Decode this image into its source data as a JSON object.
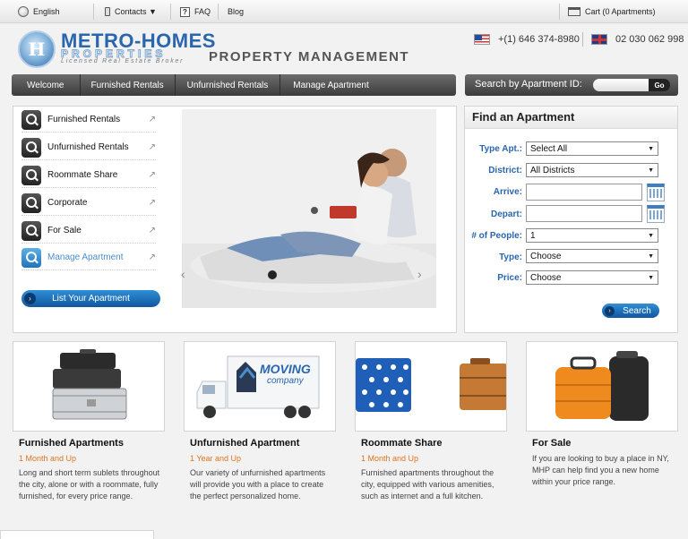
{
  "topbar": {
    "language": "English",
    "contacts": "Contacts ▼",
    "faq": "FAQ",
    "blog": "Blog",
    "cart": "Cart (0 Apartments)"
  },
  "header": {
    "logo_line1": "METRO-HOMES",
    "logo_line2": "PROPERTIES",
    "logo_tagline": "Licensed Real Estate Broker",
    "logo_initial": "H",
    "title": "PROPERTY MANAGEMENT",
    "phone_us": "+(1) 646 374-8980",
    "phone_uk": "02 030 062 998"
  },
  "nav": {
    "items": [
      "Welcome",
      "Furnished Rentals",
      "Unfurnished Rentals",
      "Manage Apartment"
    ],
    "search_label": "Search by Apartment ID:",
    "search_go": "Go"
  },
  "sidebar": {
    "items": [
      {
        "label": "Furnished Rentals"
      },
      {
        "label": "Unfurnished Rentals"
      },
      {
        "label": "Roommate Share"
      },
      {
        "label": "Corporate"
      },
      {
        "label": "For Sale"
      },
      {
        "label": "Manage Apartment"
      }
    ],
    "list_button": "List Your Apartment"
  },
  "find": {
    "title": "Find an Apartment",
    "type_label": "Type Apt.:",
    "type_value": "Select All",
    "district_label": "District:",
    "district_value": "All Districts",
    "arrive_label": "Arrive:",
    "depart_label": "Depart:",
    "people_label": "# of People:",
    "people_value": "1",
    "kind_label": "Type:",
    "kind_value": "Choose",
    "price_label": "Price:",
    "price_value": "Choose",
    "search_button": "Search"
  },
  "cards": [
    {
      "title": "Furnished Apartments",
      "sub": "1 Month and Up",
      "desc": "Long and short term sublets throughout the city, alone or with a roommate, fully furnished, for every price range."
    },
    {
      "title": "Unfurnished Apartment",
      "sub": "1 Year and Up",
      "desc": "Our variety of unfurnished apartments will provide you with a place to create the perfect personalized home."
    },
    {
      "title": "Roommate Share",
      "sub": "1 Month and Up",
      "desc": "Furnished apartments throughout the city, equipped with various amenities, such as internet and a full kitchen."
    },
    {
      "title": "For Sale",
      "sub": "",
      "desc": "If you are looking to buy a place in NY, MHP can help find you a new home within your price range."
    }
  ],
  "truck_text1": "MOVING",
  "truck_text2": "company"
}
